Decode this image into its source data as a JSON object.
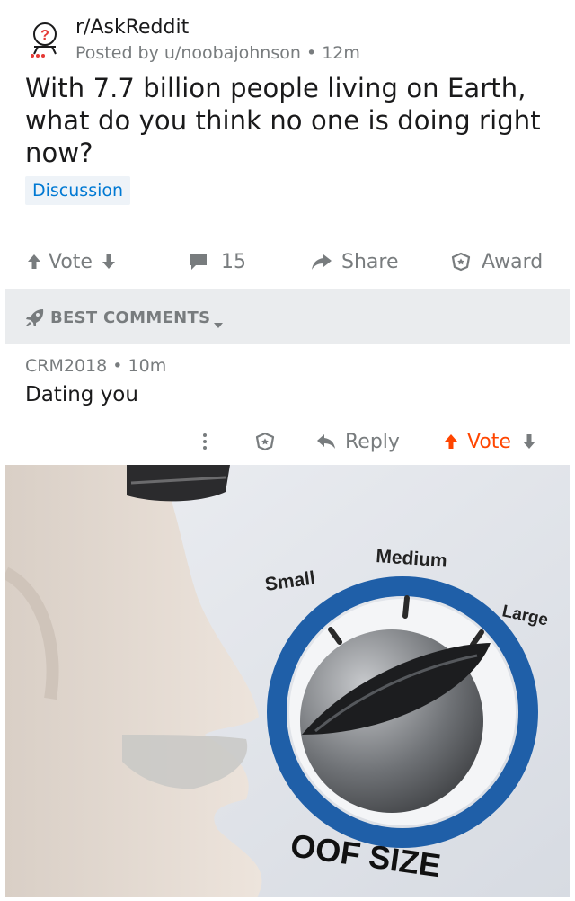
{
  "post": {
    "subreddit": "r/AskReddit",
    "posted_by": "Posted by u/noobajohnson",
    "time": "12m",
    "title": "With 7.7 billion people living on Earth, what do you think no one is doing right now?",
    "flair": "Discussion",
    "actions": {
      "vote": "Vote",
      "comments_count": "15",
      "share": "Share",
      "award": "Award"
    }
  },
  "sort": {
    "label": "BEST COMMENTS"
  },
  "comment": {
    "author": "CRM2018",
    "time": "10m",
    "body": "Dating you",
    "actions": {
      "reply": "Reply",
      "vote": "Vote"
    },
    "image": {
      "dial_labels": {
        "small": "Small",
        "medium": "Medium",
        "large": "Large"
      },
      "caption": "OOF SIZE"
    }
  },
  "colors": {
    "upvote_orange": "#ff4500",
    "link_blue": "#0079d3",
    "meta_grey": "#787c7e",
    "dial_ring_blue": "#1f5fa8"
  },
  "icons": [
    "subreddit-icon",
    "upvote-arrow-icon",
    "downvote-arrow-icon",
    "comment-icon",
    "share-arrow-icon",
    "award-icon",
    "rocket-icon",
    "caret-down-icon",
    "more-dots-icon",
    "reply-arrow-icon"
  ]
}
